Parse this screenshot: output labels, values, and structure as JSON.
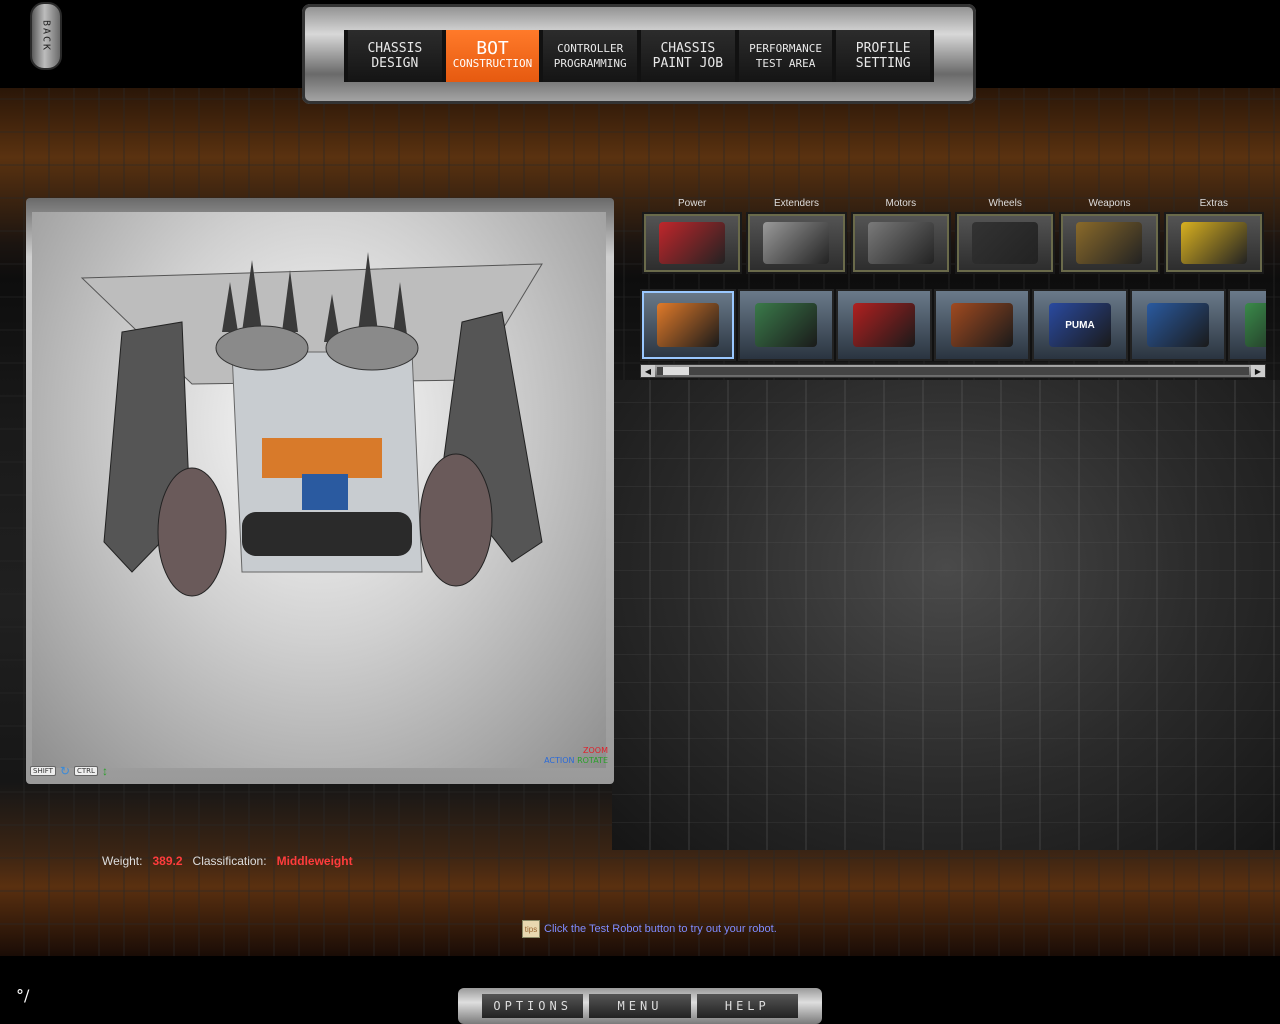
{
  "back_label": "BACK",
  "nav": {
    "tabs": [
      {
        "l1": "CHASSIS",
        "l2": "DESIGN",
        "active": false
      },
      {
        "l1": "BOT",
        "l2": "CONSTRUCTION",
        "active": true
      },
      {
        "l1": "CONTROLLER",
        "l2": "PROGRAMMING",
        "active": false
      },
      {
        "l1": "CHASSIS",
        "l2": "PAINT JOB",
        "active": false
      },
      {
        "l1": "PERFORMANCE",
        "l2": "TEST AREA",
        "active": false
      },
      {
        "l1": "PROFILE",
        "l2": "SETTING",
        "active": false
      }
    ]
  },
  "viewport": {
    "keys": {
      "shift": "SHIFT",
      "ctrl": "CTRL"
    },
    "zoom_label": "ZOOM",
    "action_label": "ACTION",
    "rotate_label": "ROTATE"
  },
  "categories": [
    {
      "label": "Power",
      "icon": "power-icon",
      "color": "#c0262b"
    },
    {
      "label": "Extenders",
      "icon": "extender-icon",
      "color": "#9a9a9a"
    },
    {
      "label": "Motors",
      "icon": "motor-icon",
      "color": "#7a7a7a"
    },
    {
      "label": "Wheels",
      "icon": "wheel-icon",
      "color": "#333333"
    },
    {
      "label": "Weapons",
      "icon": "weapon-icon",
      "color": "#8a6a2a"
    },
    {
      "label": "Extras",
      "icon": "extras-icon",
      "color": "#d8b020"
    }
  ],
  "parts": [
    {
      "icon": "battery-pack-icon",
      "color": "#e07a2a",
      "selected": true
    },
    {
      "icon": "circuit-board-icon",
      "color": "#3a7a4a",
      "selected": false
    },
    {
      "icon": "red-battery-icon",
      "color": "#b02020",
      "selected": false
    },
    {
      "icon": "battery-cluster-icon",
      "color": "#a04a20",
      "selected": false
    },
    {
      "icon": "puma-battery-icon",
      "color": "#2a4aa0",
      "text": "PUMA",
      "selected": false
    },
    {
      "icon": "blue-battery-icon",
      "color": "#2a5aa0",
      "selected": false
    },
    {
      "icon": "green-battery-icon",
      "color": "#3a8a4a",
      "selected": false
    }
  ],
  "stats": {
    "weight_label": "Weight:",
    "weight_value": "389.2",
    "class_label": "Classification:",
    "class_value": "Middleweight"
  },
  "tip": {
    "icon_text": "tips",
    "text": "Click the Test Robot button to try out your robot."
  },
  "bottom": {
    "options": "OPTIONS",
    "menu": "MENU",
    "help": "HELP"
  }
}
